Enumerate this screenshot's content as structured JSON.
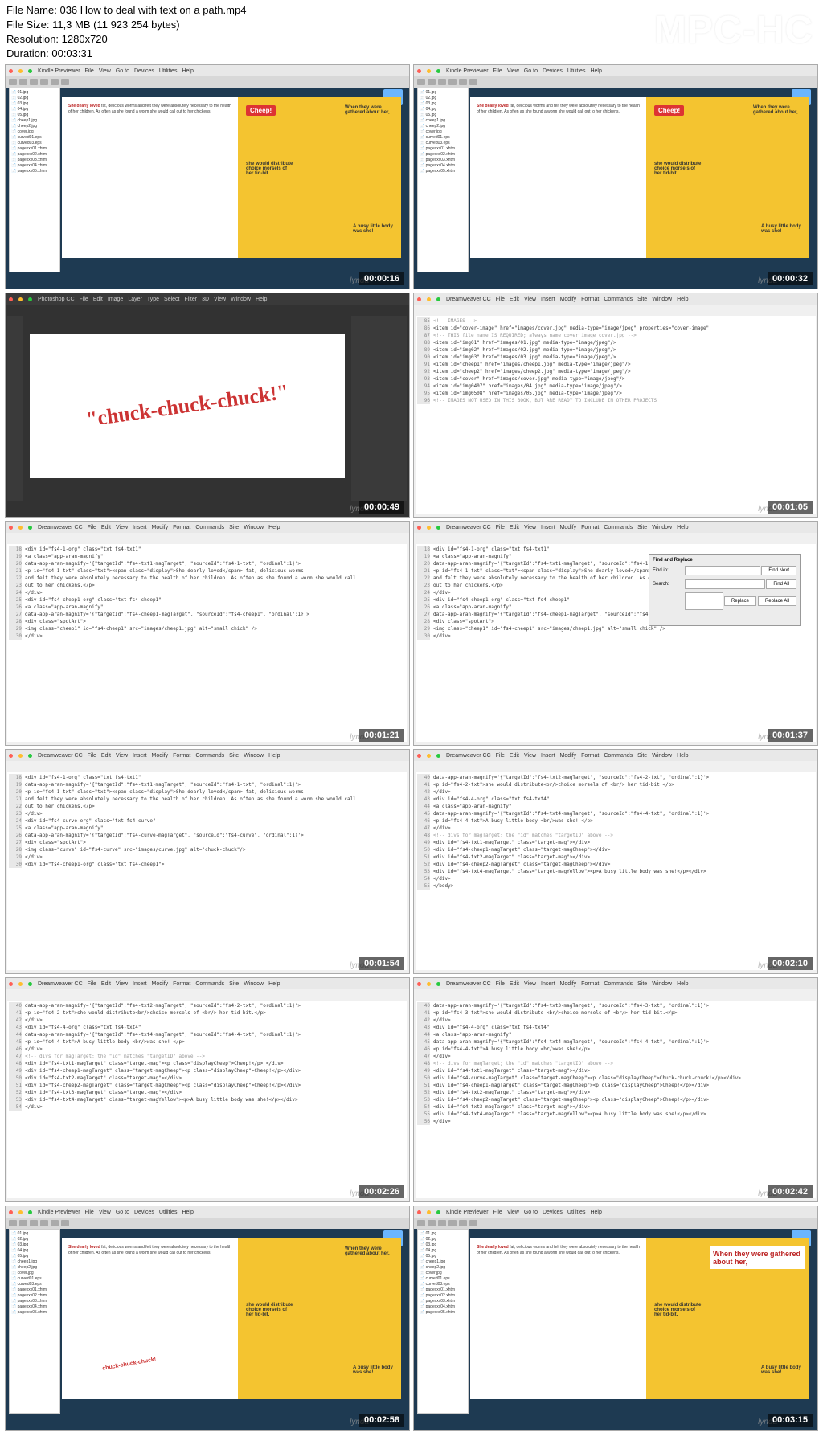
{
  "file_info": {
    "name_label": "File Name: 036 How to deal with text on a path.mp4",
    "size_label": "File Size: 11,3 MB (11 923 254 bytes)",
    "resolution_label": "Resolution: 1280x720",
    "duration_label": "Duration: 00:03:31"
  },
  "watermark": "MPC-HC",
  "watermark_thumb": "lynda",
  "menubar_kindle": [
    "Kindle Previewer",
    "File",
    "View",
    "Go to",
    "Devices",
    "Utilities",
    "Help"
  ],
  "menubar_ps": [
    "Photoshop CC",
    "File",
    "Edit",
    "Image",
    "Layer",
    "Type",
    "Select",
    "Filter",
    "3D",
    "View",
    "Window",
    "Help"
  ],
  "menubar_dw": [
    "Dreamweaver CC",
    "File",
    "Edit",
    "View",
    "Insert",
    "Modify",
    "Format",
    "Commands",
    "Site",
    "Window",
    "Help"
  ],
  "sidebar_files": [
    "01.jpg",
    "02.jpg",
    "03.jpg",
    "04.jpg",
    "05.jpg",
    "cheep1.jpg",
    "cheep2.jpg",
    "cover.jpg",
    "curved01.eps",
    "curved03.eps",
    "pagexxx01.xhtm",
    "pagexxx02.xhtm",
    "pagexxx03.xhtm",
    "pagexxx04.xhtm",
    "pagexxx05.xhtm"
  ],
  "book": {
    "left_text1": "She dearly loved",
    "left_text2": " fat, delicious worms and felt they were absolutely necessary to the health of her children. As often as she found a worm she would call out to her chickens.",
    "cheep": "Cheep!",
    "right_text1": "When they were gathered about her,",
    "right_text2": "she would distribute choice morsels of her tid-bit.",
    "right_text3": "A busy little body was she!"
  },
  "chuck_text": "\"chuck-chuck-chuck!\"",
  "dialog": {
    "title": "Find and Replace",
    "find_label": "Find in:",
    "search_label": "Search:",
    "find_btn": "Find Next",
    "findall_btn": "Find All",
    "replace_btn": "Replace",
    "replaceall_btn": "Replace All"
  },
  "code_images": [
    "<!-- IMAGES -->",
    "<item id=\"cover-image\" href=\"images/cover.jpg\" media-type=\"image/jpeg\" properties=\"cover-image\"",
    "<!-- THIS file name IS REQUIRED; always name cover image cover.jpg -->",
    "<item id=\"img01\" href=\"images/01.jpg\" media-type=\"image/jpeg\"/>",
    "<item id=\"img02\" href=\"images/02.jpg\" media-type=\"image/jpeg\"/>",
    "<item id=\"img03\" href=\"images/03.jpg\" media-type=\"image/jpeg\"/>",
    "<item id=\"cheep1\" href=\"images/cheep1.jpg\" media-type=\"image/jpeg\"/>",
    "<item id=\"cheep2\" href=\"images/cheep2.jpg\" media-type=\"image/jpeg\"/>",
    "<item id=\"cover\" href=\"images/cover.jpg\" media-type=\"image/jpeg\"/>",
    "<item id=\"img0407\" href=\"images/04.jpg\" media-type=\"image/jpeg\"/>",
    "<item id=\"img0508\" href=\"images/05.jpg\" media-type=\"image/jpeg\"/>",
    "<!-- IMAGES NOT USED IN THIS BOOK, BUT ARE READY TO INCLUDE IN OTHER PROJECTS"
  ],
  "code_div": [
    "<div id=\"fs4-1-org\" class=\"txt fs4-txt1\"",
    "<a class=\"app-aran-magnify\"",
    "data-app-aran-magnify='{\"targetId\":\"fs4-txt1-magTarget\", \"sourceId\":\"fs4-1-txt\", \"ordinal\":1}'>",
    "<p id=\"fs4-1-txt\" class=\"txt\"><span class=\"display\">She dearly loved</span> fat, delicious worms",
    "and felt they were absolutely necessary to the health of her children. As often as she found a worm she would call",
    "out to her chickens.</p>",
    "</div>",
    "<div id=\"fs4-cheep1-org\" class=\"txt fs4-cheep1\"",
    "<a class=\"app-aran-magnify\"",
    "data-app-aran-magnify='{\"targetId\":\"fs4-cheep1-magTarget\", \"sourceId\":\"fs4-cheep1\", \"ordinal\":1}'>",
    "<div class=\"spotArt\">",
    "<img class=\"cheep1\" id=\"fs4-cheep1\" src=\"images/cheep1.jpg\" alt=\"small chick\" />",
    "</div>"
  ],
  "code_curve": [
    "<div id=\"fs4-1-org\" class=\"txt fs4-txt1\"",
    "data-app-aran-magnify='{\"targetId\":\"fs4-txt1-magTarget\", \"sourceId\":\"fs4-1-txt\", \"ordinal\":1}'>",
    "<p id=\"fs4-1-txt\" class=\"txt\"><span class=\"display\">She dearly loved</span> fat, delicious worms",
    "and felt they were absolutely necessary to the health of her children. As often as she found a worm she would call",
    "out to her chickens.</p>",
    "</div>",
    "<div id=\"fs4-curve-org\" class=\"txt fs4-curve\"",
    "<a class=\"app-aran-magnify\"",
    "data-app-aran-magnify='{\"targetId\":\"fs4-curve-magTarget\", \"sourceId\":\"fs4-curve\", \"ordinal\":1}'>",
    "<div class=\"spotArt\">",
    "<img class=\"curve\" id=\"fs4-curve\" src=\"images/curve.jpg\" alt=\"chuck-chuck\"/>",
    "</div>",
    "<div id=\"fs4-cheep1-org\" class=\"txt fs4-cheep1\">"
  ],
  "code_targets": [
    "data-app-aran-magnify='{\"targetId\":\"fs4-txt3-magTarget\", \"sourceId\":\"fs4-3-txt\", \"ordinal\":1}'>",
    "<p id=\"fs4-3-txt\">she would distribute <br/>choice morsels of <br/> her tid-bit.</p>",
    "</div>",
    "<div id=\"fs4-4-org\" class=\"txt fs4-txt4\"",
    "<a class=\"app-aran-magnify\"",
    "data-app-aran-magnify='{\"targetId\":\"fs4-txt4-magTarget\", \"sourceId\":\"fs4-4-txt\", \"ordinal\":1}'>",
    "<p id=\"fs4-4-txt\">A busy little body <br/>was she!</p>",
    "</div>",
    "<!-- divs for magTarget; the \"id\" matches \"targetID\" above -->",
    "<div id=\"fs4-txt1-magTarget\" class=\"target-mag\"></div>",
    "<div id=\"fs4-curve-magTarget\" class=\"target-magCheep\"><p class=\"displayCheep\">Chuck-chuck-chuck!</p></div>",
    "<div id=\"fs4-cheep1-magTarget\" class=\"target-magCheep\"><p class=\"displayCheep\">Cheep!</p></div>",
    "<div id=\"fs4-txt2-magTarget\" class=\"target-mag\"></div>",
    "<div id=\"fs4-cheep2-magTarget\" class=\"target-magCheep\"><p class=\"displayCheep\">Cheep!</p></div>",
    "<div id=\"fs4-txt3-magTarget\" class=\"target-mag\"></div>",
    "<div id=\"fs4-txt4-magTarget\" class=\"target-magYellow\"><p>A busy little body was she!</p></div>",
    "</div>"
  ],
  "code_targets2": [
    "data-app-aran-magnify='{\"targetId\":\"fs4-txt2-magTarget\", \"sourceId\":\"fs4-2-txt\", \"ordinal\":1}'>",
    "<p id=\"fs4-2-txt\">she would distribute<br/>choice morsels of <br/> her tid-bit.</p>",
    "</div>",
    "<div id=\"fs4-4-org\" class=\"txt fs4-txt4\"",
    "data-app-aran-magnify='{\"targetId\":\"fs4-txt4-magTarget\", \"sourceId\":\"fs4-4-txt\", \"ordinal\":1}'>",
    "<p id=\"fs4-4-txt\">A busy little body <br/>was she! </p>",
    "</div>",
    "<!-- divs for magTarget; the \"id\" matches \"targetID\" above -->",
    "<div id=\"fs4-txt1-magTarget\" class=\"target-mag\"><p class=\"displayCheep\">Cheep!</p> </div>",
    "<div id=\"fs4-cheep1-magTarget\" class=\"target-magCheep\"><p class=\"displayCheep\">Cheep!</p></div>",
    "<div id=\"fs4-txt2-magTarget\" class=\"target-mag\"></div>",
    "<div id=\"fs4-cheep2-magTarget\" class=\"target-magCheep\"><p class=\"displayCheep\">Cheep!</p></div>",
    "<div id=\"fs4-txt3-magTarget\" class=\"target-mag\"></div>",
    "<div id=\"fs4-txt4-magTarget\" class=\"target-magYellow\"><p>A busy little body was she!</p></div>",
    "</div>"
  ],
  "code_body": [
    "data-app-aran-magnify='{\"targetId\":\"fs4-txt2-magTarget\", \"sourceId\":\"fs4-2-txt\", \"ordinal\":1}'>",
    "<p id=\"fs4-2-txt\">she would distribute<br/>choice morsels of <br/> her tid-bit.</p>",
    "</div>",
    "<div id=\"fs4-4-org\" class=\"txt fs4-txt4\"",
    "<a class=\"app-aran-magnify\"",
    "data-app-aran-magnify='{\"targetId\":\"fs4-txt4-magTarget\", \"sourceId\":\"fs4-4-txt\", \"ordinal\":1}'>",
    "<p id=\"fs4-4-txt\">A busy little body <br/>was she! </p>",
    "</div>",
    "<!-- divs for magTarget; the \"id\" matches \"targetID\" above -->",
    "<div id=\"fs4-txt1-magTarget\" class=\"target-mag\"></div>",
    "<div id=\"fs4-cheep1-magTarget\" class=\"target-magCheep\"></div>",
    "<div id=\"fs4-txt2-magTarget\" class=\"target-mag\"></div>",
    "<div id=\"fs4-cheep2-magTarget\" class=\"target-magCheep\"></div>",
    "<div id=\"fs4-txt4-magTarget\" class=\"target-magYellow\"><p>A busy little body was she!</p></div>",
    "</div>",
    "</body>"
  ],
  "timestamps": [
    "00:00:16",
    "00:00:32",
    "00:00:49",
    "00:01:05",
    "00:01:21",
    "00:01:37",
    "00:01:54",
    "00:02:10",
    "00:02:26",
    "00:02:42",
    "00:02:58",
    "00:03:15"
  ]
}
